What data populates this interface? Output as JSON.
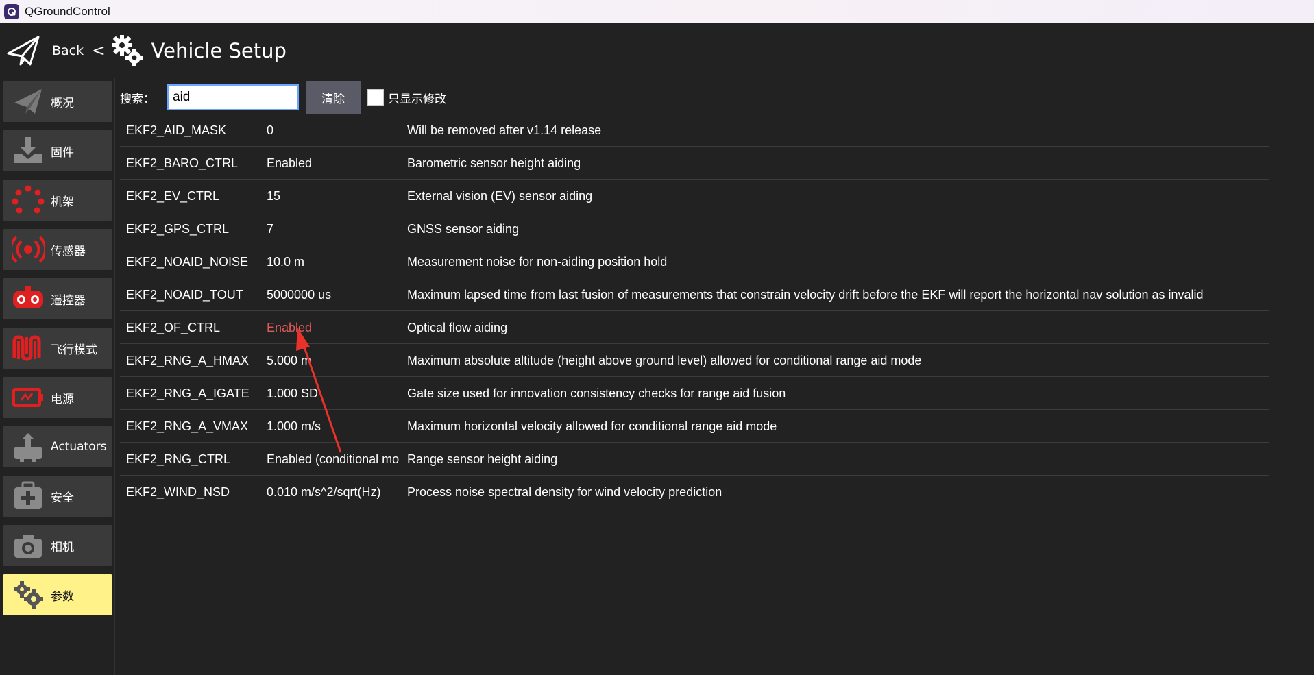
{
  "window": {
    "title": "QGroundControl"
  },
  "header": {
    "back_label": "Back",
    "separator": "<",
    "title": "Vehicle Setup"
  },
  "sidebar": {
    "items": [
      {
        "label": "概况",
        "icon": "plane-icon",
        "active": false
      },
      {
        "label": "固件",
        "icon": "download-icon",
        "active": false
      },
      {
        "label": "机架",
        "icon": "airframe-icon",
        "active": false
      },
      {
        "label": "传感器",
        "icon": "sensor-icon",
        "active": false
      },
      {
        "label": "遥控器",
        "icon": "radio-icon",
        "active": false
      },
      {
        "label": "飞行模式",
        "icon": "flight-mode-icon",
        "active": false
      },
      {
        "label": "电源",
        "icon": "battery-icon",
        "active": false
      },
      {
        "label": "Actuators",
        "icon": "actuators-icon",
        "active": false
      },
      {
        "label": "安全",
        "icon": "safety-icon",
        "active": false
      },
      {
        "label": "相机",
        "icon": "camera-icon",
        "active": false
      },
      {
        "label": "参数",
        "icon": "gears-icon",
        "active": true
      }
    ]
  },
  "search": {
    "label": "搜索：",
    "value": "aid",
    "clear_label": "清除",
    "show_modified_label": "只显示修改",
    "show_modified_checked": false
  },
  "params": [
    {
      "name": "EKF2_AID_MASK",
      "value": "0",
      "desc": "Will be removed after v1.14 release",
      "modified": false
    },
    {
      "name": "EKF2_BARO_CTRL",
      "value": "Enabled",
      "desc": "Barometric sensor height aiding",
      "modified": false
    },
    {
      "name": "EKF2_EV_CTRL",
      "value": "15",
      "desc": "External vision (EV) sensor aiding",
      "modified": false
    },
    {
      "name": "EKF2_GPS_CTRL",
      "value": "7",
      "desc": "GNSS sensor aiding",
      "modified": false
    },
    {
      "name": "EKF2_NOAID_NOISE",
      "value": "10.0 m",
      "desc": "Measurement noise for non-aiding position hold",
      "modified": false
    },
    {
      "name": "EKF2_NOAID_TOUT",
      "value": "5000000 us",
      "desc": "Maximum lapsed time from last fusion of measurements that constrain velocity drift before the EKF will report the horizontal nav solution as invalid",
      "modified": false
    },
    {
      "name": "EKF2_OF_CTRL",
      "value": "Enabled",
      "desc": "Optical flow aiding",
      "modified": true
    },
    {
      "name": "EKF2_RNG_A_HMAX",
      "value": "5.000 m",
      "desc": "Maximum absolute altitude (height above ground level) allowed for conditional range aid mode",
      "modified": false
    },
    {
      "name": "EKF2_RNG_A_IGATE",
      "value": "1.000 SD",
      "desc": "Gate size used for innovation consistency checks for range aid fusion",
      "modified": false
    },
    {
      "name": "EKF2_RNG_A_VMAX",
      "value": "1.000 m/s",
      "desc": "Maximum horizontal velocity allowed for conditional range aid mode",
      "modified": false
    },
    {
      "name": "EKF2_RNG_CTRL",
      "value": "Enabled (conditional mo",
      "desc": "Range sensor height aiding",
      "modified": false
    },
    {
      "name": "EKF2_WIND_NSD",
      "value": "0.010 m/s^2/sqrt(Hz)",
      "desc": "Process noise spectral density for wind velocity prediction",
      "modified": false
    }
  ],
  "colors": {
    "background": "#222222",
    "nav_item": "#3a3a3a",
    "nav_active": "#fff289",
    "modified_value": "#e05a5a",
    "icon_red": "#e02020",
    "icon_gray": "#8a8a8a",
    "annotation_arrow": "#e8322b"
  }
}
